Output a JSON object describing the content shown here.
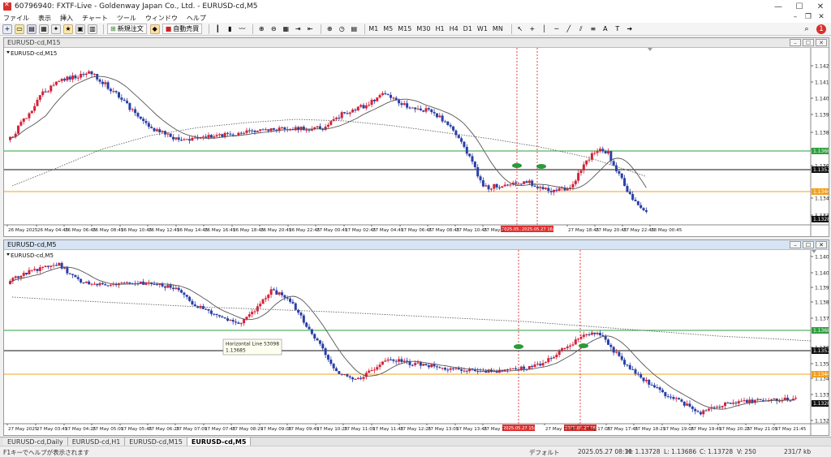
{
  "window": {
    "title": "60796940: FXTF-Live - Goldenway Japan Co., Ltd. - EURUSD-cd,M5"
  },
  "menu": [
    "ファイル",
    "表示",
    "挿入",
    "チャート",
    "ツール",
    "ウィンドウ",
    "ヘルプ"
  ],
  "toolbar": {
    "new_order": "新規注文",
    "auto_trade": "自動売買",
    "timeframes": [
      "M1",
      "M5",
      "M15",
      "M30",
      "H1",
      "H4",
      "D1",
      "W1",
      "MN"
    ]
  },
  "colors": {
    "bull": "#d3233a",
    "bear": "#2a3fa8",
    "green_line": "#2e9e3e",
    "orange_line": "#f0a020",
    "black_line": "#111111",
    "marker": "#2a9a3a",
    "vline": "#e03030"
  },
  "top_chart": {
    "title": "EURUSD-cd,M15",
    "label": "EURUSD-cd,M15",
    "price_ticks": [
      "1.14200",
      "1.14110",
      "1.14020",
      "1.13930",
      "1.13840",
      "1.13750",
      "1.13660",
      "1.13480",
      "1.13390",
      "1.13210"
    ],
    "line_labels": {
      "green": "1.13685",
      "black": "1.13578",
      "orange": "1.13446",
      "bottom": "1.13286"
    },
    "time_labels": [
      "26 May 2025",
      "26 May 04:45",
      "26 May 06:45",
      "26 May 08:45",
      "26 May 10:45",
      "26 May 12:45",
      "26 May 14:45",
      "26 May 16:45",
      "26 May 18:45",
      "26 May 20:45",
      "26 May 22:45",
      "27 May 00:45",
      "27 May 02:45",
      "27 May 04:45",
      "27 May 06:45",
      "27 May 08:45",
      "27 May 10:45",
      "27 May 1",
      "2:45",
      "27 May 18:45",
      "27 May 20:45",
      "27 May 22:45",
      "28 May 00:45"
    ],
    "vline_labels": [
      "2025.05.27 15:45",
      "2025.05.27 16:45"
    ]
  },
  "bottom_chart": {
    "title": "EURUSD-cd,M5",
    "label": "EURUSD-cd,M5",
    "price_ticks": [
      "1.14085",
      "1.14005",
      "1.13925",
      "1.13845",
      "1.13765",
      "1.13605",
      "1.13525",
      "1.13445",
      "1.13365",
      "1.13205"
    ],
    "line_labels": {
      "green": "1.13685",
      "black": "1.13578",
      "orange": "1.13446",
      "bottom": "1.13286"
    },
    "time_labels": [
      "27 May 2025",
      "27 May 03:45",
      "27 May 04:25",
      "27 May 05:05",
      "27 May 05:45",
      "27 May 06:25",
      "27 May 07:05",
      "27 May 07:45",
      "27 May 08:25",
      "27 May 09:05",
      "27 May 09:45",
      "27 May 10:25",
      "27 May 11:05",
      "27 May 11:45",
      "27 May 12:25",
      "27 May 13:05",
      "27 May 13:45",
      "27 May 1",
      "27 May 15:45",
      "27 May 17:05",
      "27 May 17:45",
      "27 May 18:25",
      "27 May 19:05",
      "27 May 19:45",
      "27 May 20:25",
      "27 May 21:05",
      "27 May 21:45"
    ],
    "vline_labels": [
      "2025.05.27 15:05",
      "2025.05.27 16:45"
    ],
    "tooltip": {
      "line1": "Horizontal Line 53098",
      "line2": "1.13685"
    }
  },
  "tabs": [
    "EURUSD-cd,Daily",
    "EURUSD-cd,H1",
    "EURUSD-cd,M15",
    "EURUSD-cd,M5"
  ],
  "status": {
    "hint": "F1キーでヘルプが表示されます",
    "profile": "デフォルト",
    "datetime": "2025.05.27 08:10",
    "high": "H: 1.13728",
    "low": "L: 1.13686",
    "close": "C: 1.13728",
    "volume": "V: 250",
    "traffic": "231/7 kb"
  }
}
